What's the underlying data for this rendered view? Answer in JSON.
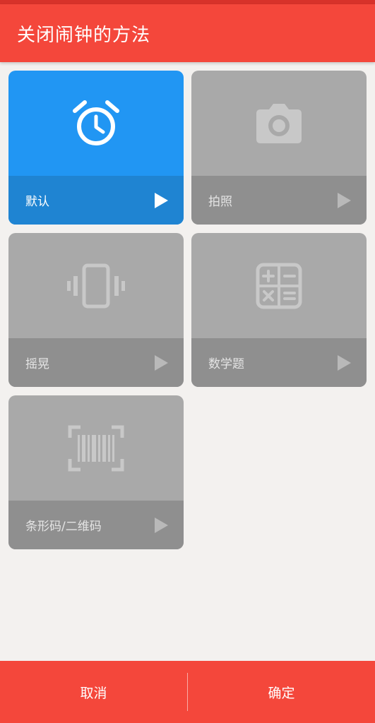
{
  "header": {
    "title": "关闭闹钟的方法"
  },
  "methods": [
    {
      "label": "默认",
      "icon": "alarm-clock-icon",
      "selected": true
    },
    {
      "label": "拍照",
      "icon": "camera-icon",
      "selected": false
    },
    {
      "label": "摇晃",
      "icon": "vibrate-phone-icon",
      "selected": false
    },
    {
      "label": "数学题",
      "icon": "calculator-icon",
      "selected": false
    },
    {
      "label": "条形码/二维码",
      "icon": "barcode-scan-icon",
      "selected": false
    }
  ],
  "footer": {
    "cancel_label": "取消",
    "confirm_label": "确定"
  },
  "colors": {
    "accent_red": "#f4473b",
    "selected_blue": "#2196f3",
    "inactive_gray": "#a9a9a9"
  }
}
